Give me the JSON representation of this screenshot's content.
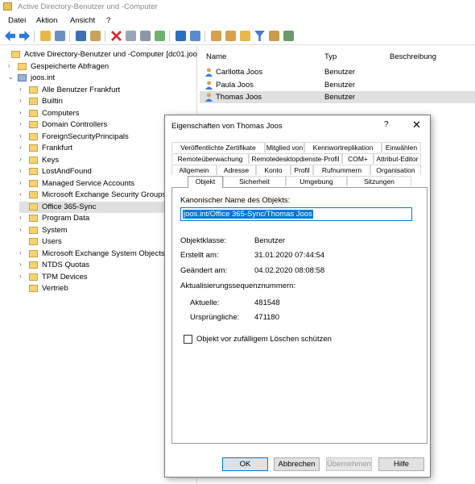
{
  "window": {
    "title": "Active Directory-Benutzer und -Computer"
  },
  "menu": [
    "Datei",
    "Aktion",
    "Ansicht",
    "?"
  ],
  "tree": [
    {
      "label": "Active Directory-Benutzer und -Computer [dc01.joo",
      "level": 0,
      "arrow": ""
    },
    {
      "label": "Gespeicherte Abfragen",
      "level": 1,
      "arrow": "›"
    },
    {
      "label": "joos.int",
      "level": 1,
      "arrow": "⌄"
    },
    {
      "label": "Alle Benutzer Frankfurt",
      "level": 2,
      "arrow": "›"
    },
    {
      "label": "Builtin",
      "level": 2,
      "arrow": "›"
    },
    {
      "label": "Computers",
      "level": 2,
      "arrow": "›"
    },
    {
      "label": "Domain Controllers",
      "level": 2,
      "arrow": "›"
    },
    {
      "label": "ForeignSecurityPrincipals",
      "level": 2,
      "arrow": "›"
    },
    {
      "label": "Frankfurt",
      "level": 2,
      "arrow": "›"
    },
    {
      "label": "Keys",
      "level": 2,
      "arrow": "›"
    },
    {
      "label": "LostAndFound",
      "level": 2,
      "arrow": "›"
    },
    {
      "label": "Managed Service Accounts",
      "level": 2,
      "arrow": "›"
    },
    {
      "label": "Microsoft Exchange Security Groups",
      "level": 2,
      "arrow": "›"
    },
    {
      "label": "Office 365-Sync",
      "level": 2,
      "arrow": "",
      "selected": true
    },
    {
      "label": "Program Data",
      "level": 2,
      "arrow": "›"
    },
    {
      "label": "System",
      "level": 2,
      "arrow": "›"
    },
    {
      "label": "Users",
      "level": 2,
      "arrow": ""
    },
    {
      "label": "Microsoft Exchange System Objects",
      "level": 2,
      "arrow": "›"
    },
    {
      "label": "NTDS Quotas",
      "level": 2,
      "arrow": "›"
    },
    {
      "label": "TPM Devices",
      "level": 2,
      "arrow": "›"
    },
    {
      "label": "Vertrieb",
      "level": 2,
      "arrow": ""
    }
  ],
  "list": {
    "columns": [
      "Name",
      "Typ",
      "Beschreibung"
    ],
    "rows": [
      {
        "name": "Carllotta Joos",
        "type": "Benutzer"
      },
      {
        "name": "Paula Joos",
        "type": "Benutzer"
      },
      {
        "name": "Thomas Joos",
        "type": "Benutzer"
      }
    ]
  },
  "dialog": {
    "title": "Eigenschaften von Thomas Joos",
    "help": "?",
    "close": "✕",
    "tabs_row1": [
      "Veröffentlichte Zertifikate",
      "Mitglied von",
      "Kennwortreplikation",
      "Einwählen"
    ],
    "tabs_row2": [
      "Remoteüberwachung",
      "Remotedesktopdienste-Profil",
      "COM+",
      "Attribut-Editor"
    ],
    "tabs_row3": [
      "Allgemein",
      "Adresse",
      "Konto",
      "Profil",
      "Rufnummern",
      "Organisation"
    ],
    "tabs_row4": [
      "Objekt",
      "Sicherheit",
      "Umgebung",
      "Sitzungen"
    ],
    "canonical_label": "Kanonischer Name des Objekts:",
    "canonical_value": "joos.int/Office 365-Sync/Thomas Joos",
    "class_label": "Objektklasse:",
    "class_value": "Benutzer",
    "created_label": "Erstellt am:",
    "created_value": "31.01.2020 07:44:54",
    "changed_label": "Geändert am:",
    "changed_value": "04.02.2020 08:08:58",
    "usn_label": "Aktualisierungssequenznummern:",
    "current_label": "Aktuelle:",
    "current_value": "481548",
    "original_label": "Ursprüngliche:",
    "original_value": "471180",
    "protect_label": "Objekt vor zufälligem Löschen schützen",
    "buttons": {
      "ok": "OK",
      "cancel": "Abbrechen",
      "apply": "Übernehmen",
      "help": "Hilfe"
    }
  }
}
